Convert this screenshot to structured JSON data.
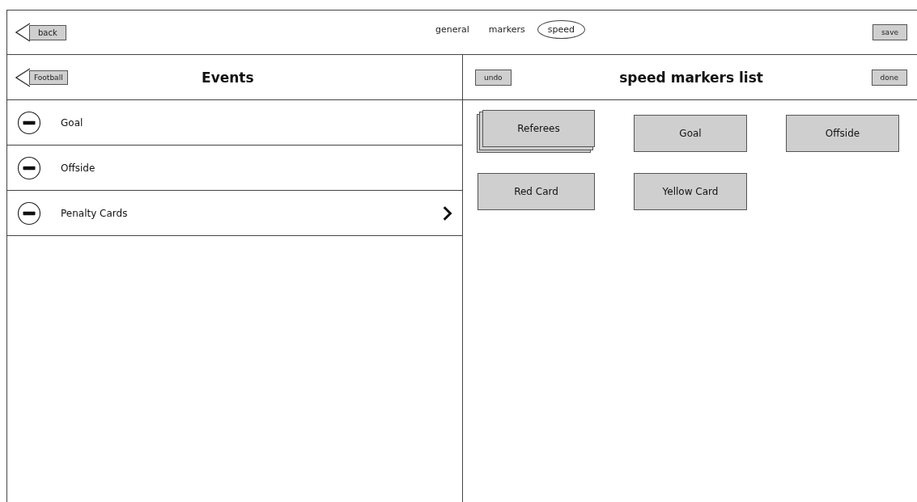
{
  "top_bar": {
    "back_button": "back",
    "tabs": [
      {
        "label": "general",
        "selected": false
      },
      {
        "label": "markers",
        "selected": false
      },
      {
        "label": "speed",
        "selected": true
      }
    ],
    "save_button": "save"
  },
  "events_panel": {
    "back_button": "Football",
    "title": "Events",
    "rows": [
      {
        "label": "Goal",
        "has_detail": false
      },
      {
        "label": "Offside",
        "has_detail": false
      },
      {
        "label": "Penalty Cards",
        "has_detail": true
      }
    ]
  },
  "markers_panel": {
    "undo_button": "undo",
    "title": "speed markers list",
    "done_button": "done",
    "markers": [
      {
        "label": "Referees",
        "kind": "stack"
      },
      {
        "label": "Goal",
        "kind": "single"
      },
      {
        "label": "Offside",
        "kind": "single"
      },
      {
        "label": "Red Card",
        "kind": "single"
      },
      {
        "label": "Yellow Card",
        "kind": "single"
      }
    ]
  }
}
